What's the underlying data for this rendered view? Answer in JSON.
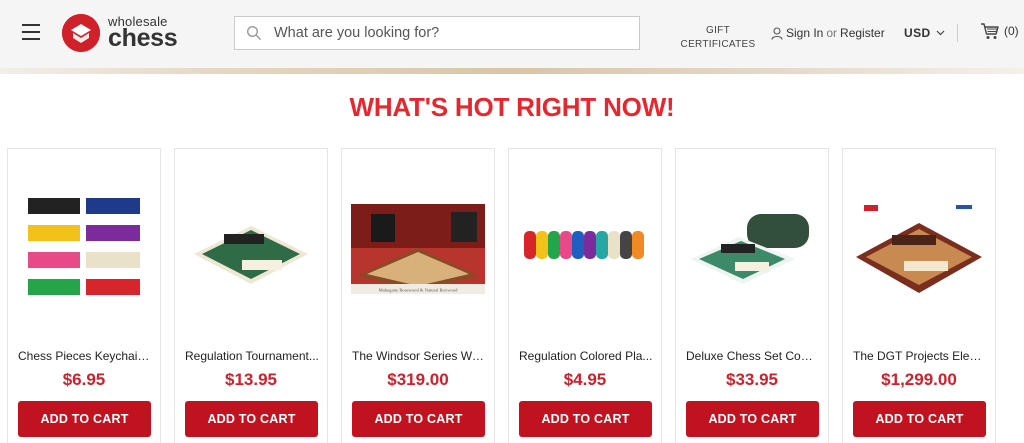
{
  "header": {
    "logo_small": "wholesale",
    "logo_big": "chess",
    "search_placeholder": "What are you looking for?",
    "gift_line1": "GIFT",
    "gift_line2": "CERTIFICATES",
    "sign_in": "Sign In",
    "or": "or",
    "register": "Register",
    "currency": "USD",
    "cart_count": "(0)"
  },
  "section": {
    "heading": "WHAT'S HOT RIGHT NOW!"
  },
  "products": [
    {
      "name": "Chess Pieces Keychain Set",
      "display_name": "Chess Pieces Keychain...",
      "price": "$6.95",
      "button": "ADD TO CART"
    },
    {
      "name": "Regulation Tournament Chess Set",
      "display_name": "Regulation Tournament...",
      "price": "$13.95",
      "button": "ADD TO CART"
    },
    {
      "name": "The Windsor Series Wood Chess Set",
      "display_name": "The Windsor Series Wo...",
      "price": "$319.00",
      "button": "ADD TO CART"
    },
    {
      "name": "Regulation Colored Plastic Chess Pieces",
      "display_name": "Regulation Colored Pla...",
      "price": "$4.95",
      "button": "ADD TO CART"
    },
    {
      "name": "Deluxe Chess Set Combo",
      "display_name": "Deluxe Chess Set Com...",
      "price": "$33.95",
      "button": "ADD TO CART"
    },
    {
      "name": "The DGT Projects Electronic Chess Board",
      "display_name": "The DGT Projects Elect...",
      "price": "$1,299.00",
      "button": "ADD TO CART"
    }
  ],
  "image_caption_3": "Mahogany Rosewood & Natural Boxwood",
  "colors": {
    "brand_red": "#d0202a",
    "button_red": "#c1121f",
    "heading_red": "#e8262d"
  }
}
